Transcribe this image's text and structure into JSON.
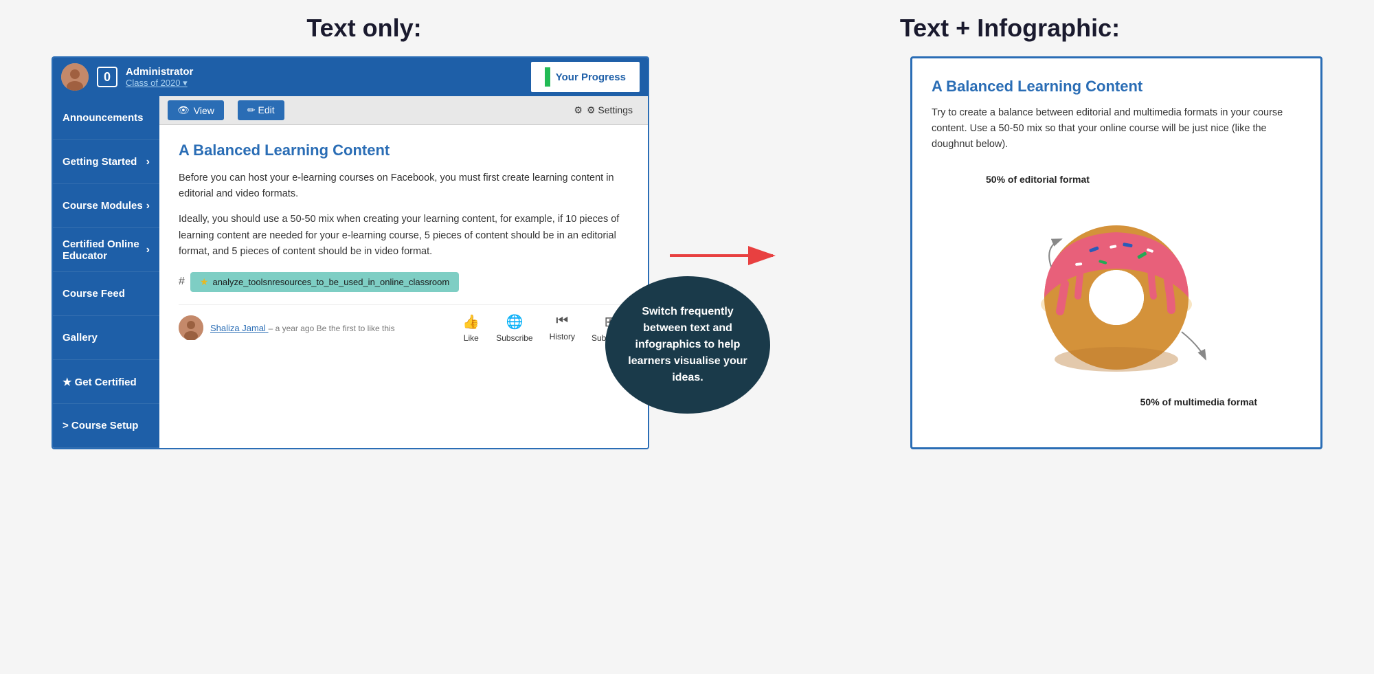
{
  "header": {
    "left_label": "Text only:",
    "right_label": "Text + Infographic:"
  },
  "topbar": {
    "notification_count": "0",
    "user_name": "Administrator",
    "user_class": "Class of 2020 ▾",
    "progress_btn": "Your Progress"
  },
  "sidebar": {
    "items": [
      {
        "id": "announcements",
        "label": "Announcements",
        "has_chevron": false
      },
      {
        "id": "getting-started",
        "label": "Getting Started",
        "has_chevron": true
      },
      {
        "id": "course-modules",
        "label": "Course Modules",
        "has_chevron": true
      },
      {
        "id": "certified-online-educator",
        "label": "Certified Online Educator",
        "has_chevron": true
      },
      {
        "id": "course-feed",
        "label": "Course Feed",
        "has_chevron": false
      },
      {
        "id": "gallery",
        "label": "Gallery",
        "has_chevron": false
      },
      {
        "id": "get-certified",
        "label": "★ Get Certified",
        "has_chevron": false
      },
      {
        "id": "course-setup",
        "label": "> Course Setup",
        "has_chevron": false
      }
    ]
  },
  "toolbar": {
    "view_label": "View",
    "edit_label": "✏ Edit",
    "settings_label": "⚙ Settings"
  },
  "content": {
    "title": "A Balanced Learning Content",
    "para1": "Before you can host your e-learning courses on Facebook, you must first create learning content in editorial and video formats.",
    "para2": "Ideally, you should use a 50-50 mix when creating your learning content, for example, if 10 pieces of learning content are needed for your e-learning course, 5 pieces of content should be in an editorial format, and 5 pieces of content should be in video format.",
    "tag": "analyze_toolsnresources_to_be_used_in_online_classroom",
    "comment_author": "Shaliza Jamal",
    "comment_time": "– a year ago",
    "comment_note": "Be the first to like this",
    "btn_like": "Like",
    "btn_subscribe": "Subscribe",
    "btn_history": "History",
    "btn_subpages": "Subpages"
  },
  "bubble": {
    "text": "Switch frequently between text and infographics to help learners visualise your ideas."
  },
  "infographic": {
    "title": "A Balanced Learning Content",
    "text": "Try to create a balance between editorial and multimedia formats in your course content. Use a 50-50 mix so that your online course will be just nice (like the doughnut below).",
    "label_top": "50% of editorial format",
    "label_bottom": "50% of multimedia format"
  }
}
